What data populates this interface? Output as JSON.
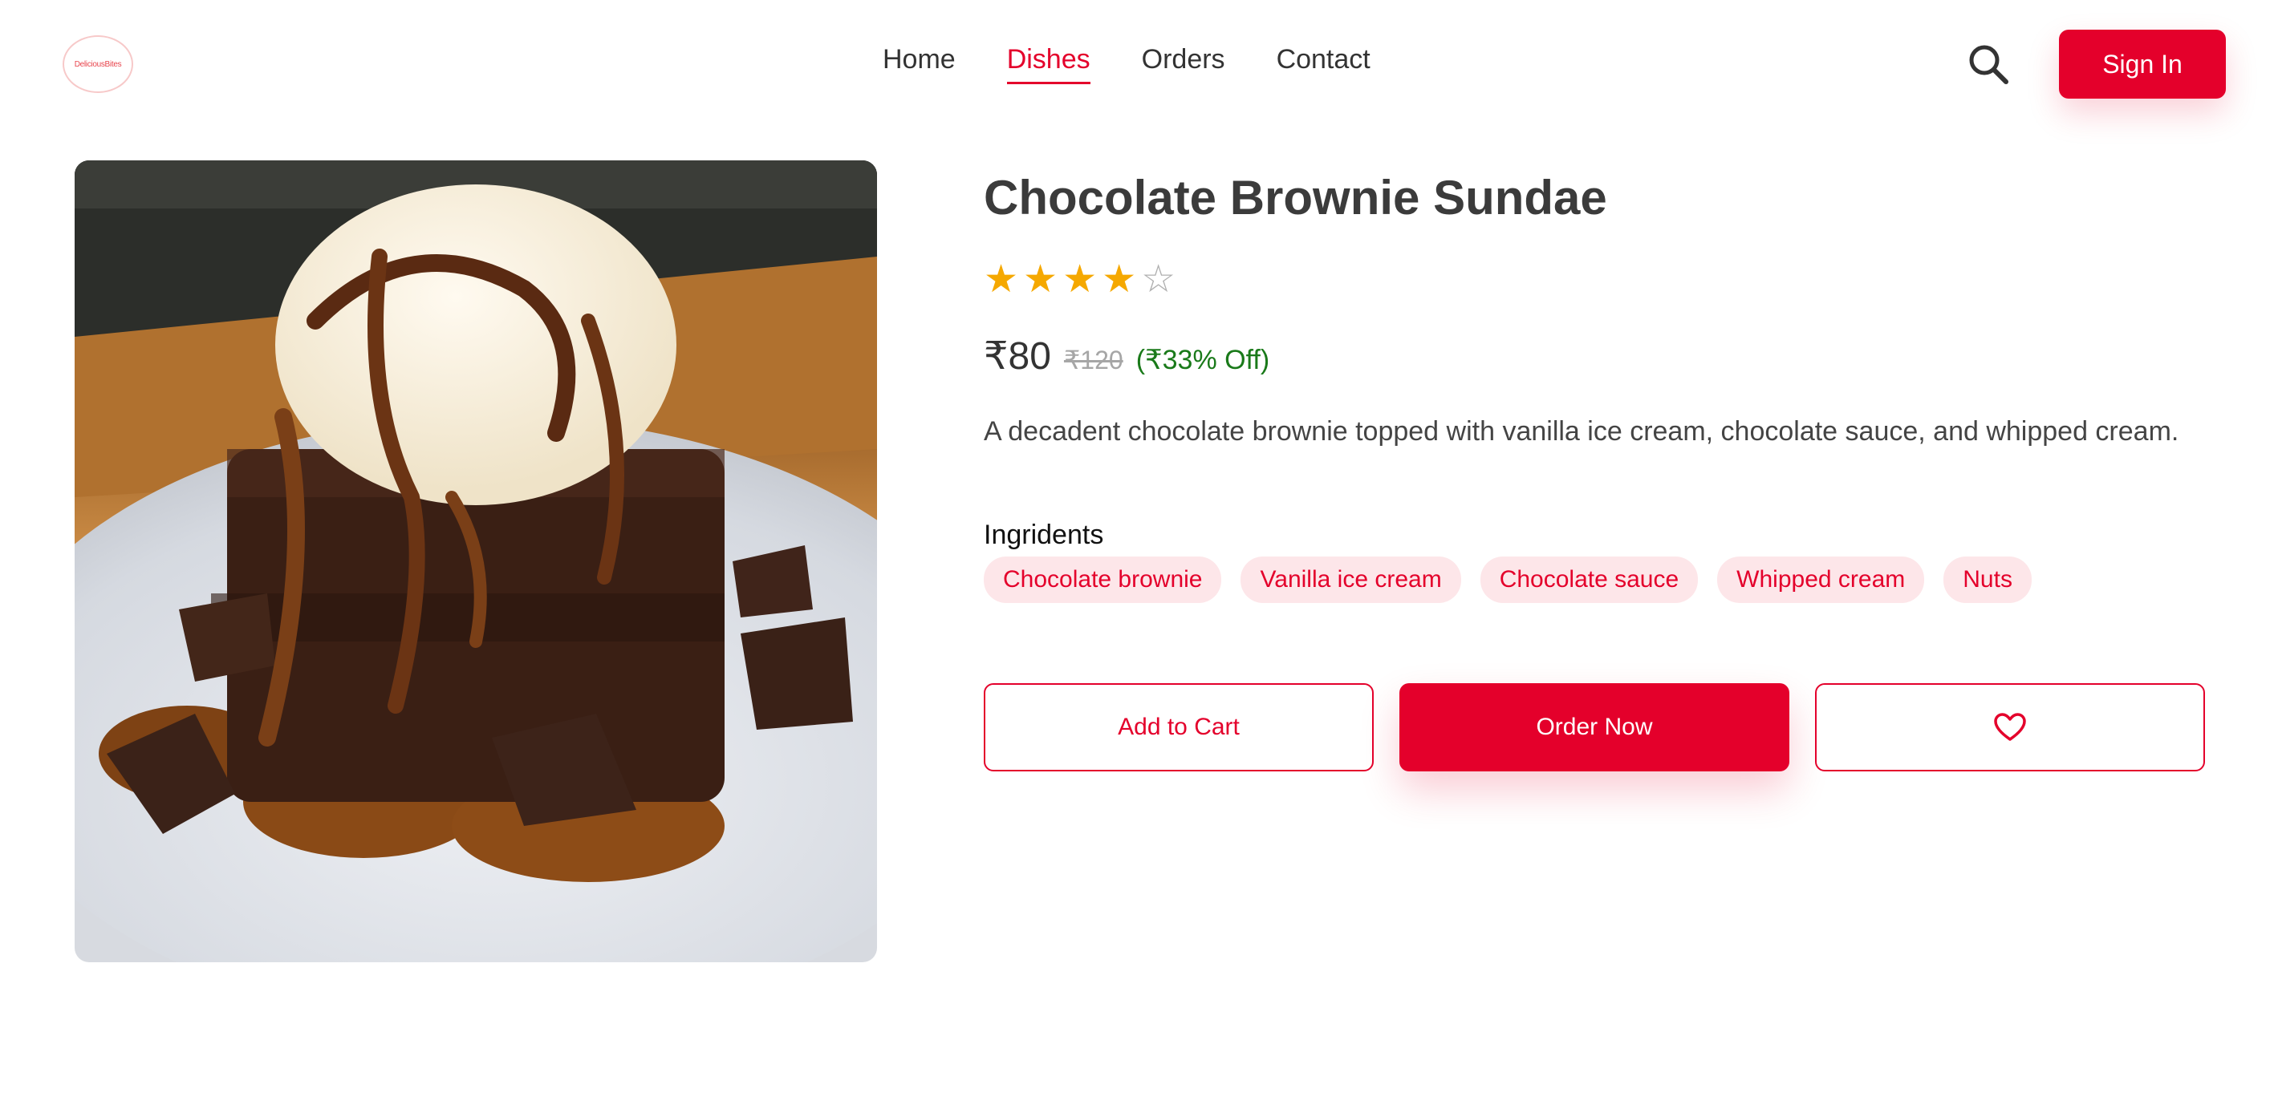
{
  "header": {
    "logo_text": "DeliciousBites",
    "nav": [
      {
        "label": "Home",
        "active": false
      },
      {
        "label": "Dishes",
        "active": true
      },
      {
        "label": "Orders",
        "active": false
      },
      {
        "label": "Contact",
        "active": false
      }
    ],
    "search_icon": "search-icon",
    "signin_label": "Sign In"
  },
  "product": {
    "image_alt": "Chocolate Brownie Sundae",
    "title": "Chocolate Brownie Sundae",
    "rating": 4,
    "rating_max": 5,
    "price": "₹80",
    "old_price": "₹120",
    "discount": "(₹33% Off)",
    "description": "A decadent chocolate brownie topped with vanilla ice cream, chocolate sauce, and whipped cream.",
    "ingredients_title": "Ingridents",
    "ingredients": [
      "Chocolate brownie",
      "Vanilla ice cream",
      "Chocolate sauce",
      "Whipped cream",
      "Nuts"
    ]
  },
  "actions": {
    "add_to_cart": "Add to Cart",
    "order_now": "Order Now",
    "wishlist_icon": "heart-icon"
  },
  "colors": {
    "accent": "#e4002b",
    "tag_bg": "#fde6e9",
    "star": "#f5a800",
    "star_empty": "#b0b0b0",
    "discount": "#1a7a1a"
  }
}
